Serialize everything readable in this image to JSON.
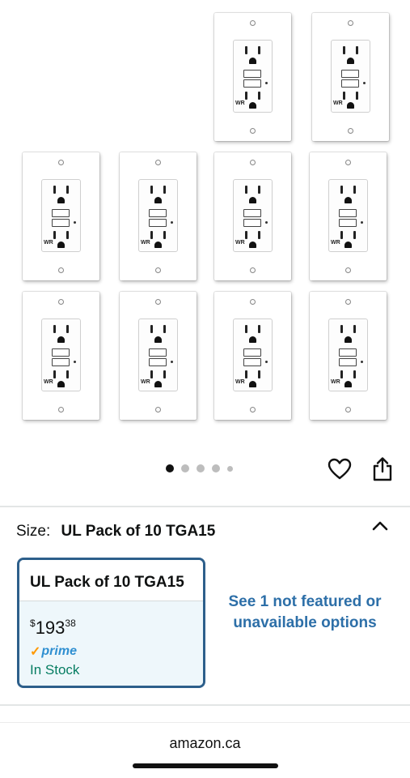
{
  "gallery": {
    "product_image": "white-gfci-outlet-wall-plates",
    "plate_label": "WR",
    "carousel": {
      "pages": 5,
      "active": 1
    }
  },
  "actions": {
    "favorite_icon": "heart-icon",
    "share_icon": "share-icon"
  },
  "size": {
    "label": "Size:",
    "selected": "UL Pack of 10 TGA15",
    "collapse_icon": "chevron-up-icon"
  },
  "swatch": {
    "title": "UL Pack of 10 TGA15",
    "price_symbol": "$",
    "price_whole": "193",
    "price_fraction": "38",
    "prime_check": "✓",
    "prime_label": "prime",
    "availability": "In Stock"
  },
  "other_options": {
    "link": "See 1 not featured or unavailable options"
  },
  "footer": {
    "domain": "amazon.ca"
  },
  "colors": {
    "selected_border": "#2d5f8b",
    "link": "#2d6fa8",
    "in_stock": "#067d62",
    "prime_blue": "#2f8fd1",
    "prime_orange": "#ff9900"
  }
}
